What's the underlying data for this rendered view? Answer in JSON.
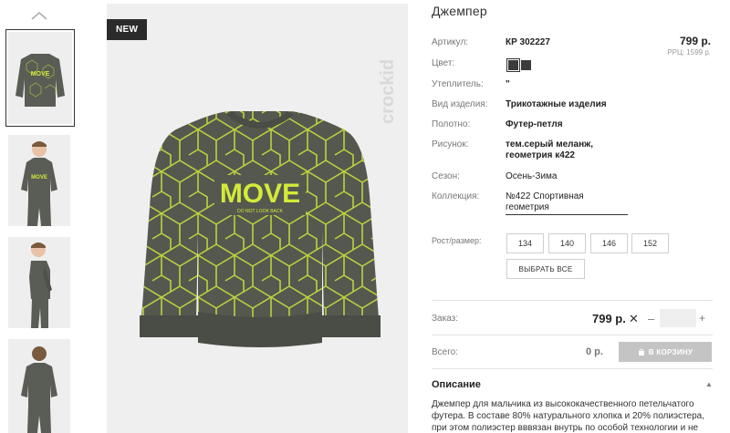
{
  "gallery": {
    "badge": "NEW",
    "brand": "crockid"
  },
  "product": {
    "title": "Джемпер",
    "price": "799 р.",
    "rrp": "РРЦ: 1599 р.",
    "specs": [
      {
        "label": "Артикул:",
        "value": "КР 302227"
      },
      {
        "label": "Цвет:",
        "value": ""
      },
      {
        "label": "Утеплитель:",
        "value": "\""
      },
      {
        "label": "Вид изделия:",
        "value": "Трикотажные изделия"
      },
      {
        "label": "Полотно:",
        "value": "Футер-петля"
      },
      {
        "label": "Рисунок:",
        "value": "тем.серый меланж, геометрия к422"
      },
      {
        "label": "Сезон:",
        "value": "Осень-Зима"
      },
      {
        "label": "Коллекция:",
        "value": "№422 Спортивная геометрия"
      }
    ],
    "colors": [
      "#3c3c3c",
      "#3c3c3c"
    ]
  },
  "sizes": {
    "label": "Рост/размер:",
    "options": [
      "134",
      "140",
      "146",
      "152"
    ],
    "select_all": "ВЫБРАТЬ ВСЕ"
  },
  "order": {
    "label": "Заказ:",
    "price": "799 р.",
    "remove": "✕",
    "minus": "–",
    "plus": "+",
    "quantity": ""
  },
  "total": {
    "label": "Всего:",
    "value": "0 р.",
    "cart_button": "В КОРЗИНУ"
  },
  "description": {
    "title": "Описание",
    "toggle": "▲",
    "text": "Джемпер для мальчика из высококачественного петельчатого футера. В составе 80% натурального хлопка и 20% полиэстера, при этом полиэстер вввязан внутрь по особой технологии и не"
  },
  "print": {
    "headline": "MOVE",
    "tagline": "DO NOT LOOK BACK"
  }
}
